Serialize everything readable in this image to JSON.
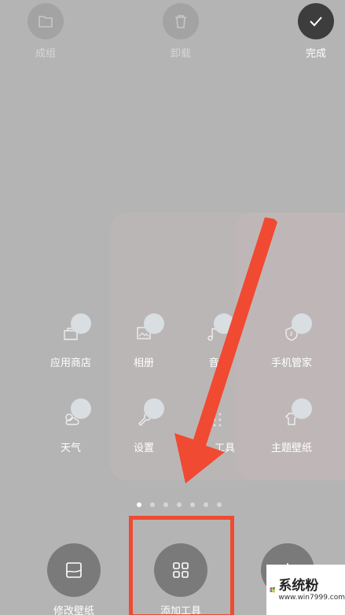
{
  "top_actions": {
    "group": "成组",
    "uninstall": "卸载",
    "done": "完成"
  },
  "apps": [
    {
      "name": "应用商店",
      "icon": "app-store-icon"
    },
    {
      "name": "相册",
      "icon": "gallery-icon"
    },
    {
      "name": "音",
      "icon": "music-icon"
    },
    {
      "name": "手机管家",
      "icon": "phone-manager-icon"
    },
    {
      "name": "天气",
      "icon": "weather-icon"
    },
    {
      "name": "设置",
      "icon": "settings-icon"
    },
    {
      "name": "工具",
      "icon": "tools-folder-icon"
    },
    {
      "name": "主题壁纸",
      "icon": "theme-icon"
    }
  ],
  "page_indicator": {
    "count": 7,
    "active": 1
  },
  "bottom_actions": {
    "wallpaper": "修改壁纸",
    "add_widget": "添加工具"
  },
  "watermark": {
    "main": "系统粉",
    "url": "www.win7999.com"
  },
  "colors": {
    "highlight": "#f04a32",
    "arrow": "#f04a32",
    "background": "#b4b4b4"
  }
}
